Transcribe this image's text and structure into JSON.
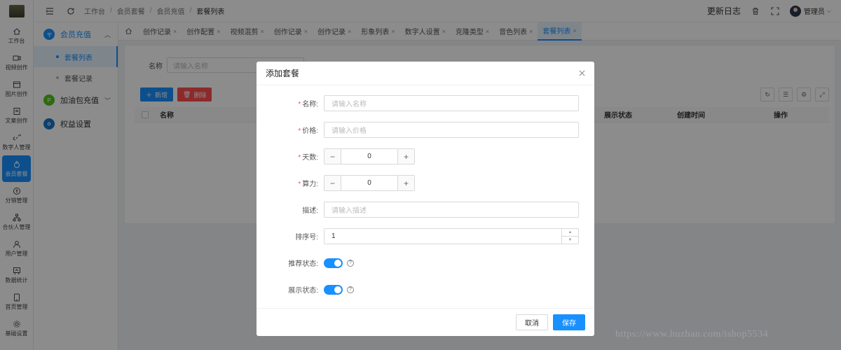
{
  "rail": {
    "items": [
      {
        "label": "工作台",
        "icon": "home-icon"
      },
      {
        "label": "视频创作",
        "icon": "video-icon"
      },
      {
        "label": "图片创作",
        "icon": "image-icon"
      },
      {
        "label": "文案创作",
        "icon": "document-icon"
      },
      {
        "label": "数字人管理",
        "icon": "link-icon"
      },
      {
        "label": "会员套餐",
        "icon": "flame-icon"
      },
      {
        "label": "分销管理",
        "icon": "coin-icon"
      },
      {
        "label": "合伙人管理",
        "icon": "org-icon"
      },
      {
        "label": "用户管理",
        "icon": "user-icon"
      },
      {
        "label": "数据统计",
        "icon": "chart-icon"
      },
      {
        "label": "首页管理",
        "icon": "tablet-icon"
      },
      {
        "label": "基础设置",
        "icon": "gear-icon"
      }
    ],
    "active_index": 5
  },
  "subnav": {
    "group1": "会员充值",
    "item1": "套餐列表",
    "item2": "套餐记录",
    "group2": "加油包充值",
    "group3": "权益设置"
  },
  "header": {
    "crumbs": [
      "工作台",
      "会员套餐",
      "会员充值",
      "套餐列表"
    ],
    "changelog": "更新日志",
    "user": "管理员"
  },
  "tabs": [
    "创作记录",
    "创作配置",
    "视频混剪",
    "创作记录",
    "创作记录",
    "形象列表",
    "数字人设置",
    "克隆类型",
    "音色列表",
    "套餐列表"
  ],
  "background": {
    "search_label": "名称",
    "search_placeholder": "请输入名称",
    "add_button": "新增",
    "delete_button": "删除",
    "columns": {
      "name": "名称",
      "show_status": "展示状态",
      "created": "创建时间",
      "ops": "操作"
    }
  },
  "modal": {
    "title": "添加套餐",
    "name_label": "名称",
    "name_placeholder": "请输入名称",
    "price_label": "价格",
    "price_placeholder": "请输入价格",
    "days_label": "天数",
    "days_value": "0",
    "power_label": "算力",
    "power_value": "0",
    "desc_label": "描述",
    "desc_placeholder": "请输入描述",
    "sort_label": "排序号",
    "sort_value": "1",
    "recommend_label": "推荐状态",
    "recommend_on": true,
    "show_label": "展示状态",
    "show_on": true,
    "cancel": "取消",
    "save": "保存"
  },
  "watermark": "https://www.huzhan.com/ishop5534",
  "colors": {
    "primary": "#1890ff",
    "danger": "#ff4d4f",
    "required": "#ff4d4f"
  }
}
